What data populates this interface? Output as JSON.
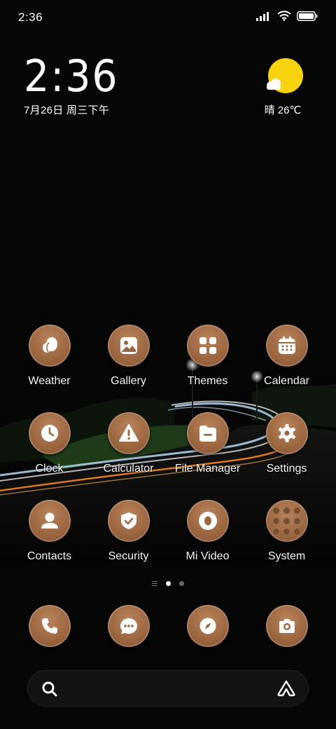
{
  "status_bar": {
    "time": "2:36",
    "icons": [
      "signal-icon",
      "wifi-icon",
      "battery-icon"
    ]
  },
  "clock_widget": {
    "time": "2:36",
    "date": "7月26日 周三下午"
  },
  "weather_widget": {
    "icon": "sun-cloud-icon",
    "text": "晴 26℃"
  },
  "apps": [
    {
      "label": "Weather",
      "icon": "weather-icon"
    },
    {
      "label": "Gallery",
      "icon": "gallery-icon"
    },
    {
      "label": "Themes",
      "icon": "themes-icon"
    },
    {
      "label": "Calendar",
      "icon": "calendar-icon"
    },
    {
      "label": "Clock",
      "icon": "clock-icon"
    },
    {
      "label": "Calculator",
      "icon": "calculator-icon"
    },
    {
      "label": "File Manager",
      "icon": "file-manager-icon"
    },
    {
      "label": "Settings",
      "icon": "settings-icon"
    },
    {
      "label": "Contacts",
      "icon": "contacts-icon"
    },
    {
      "label": "Security",
      "icon": "security-icon"
    },
    {
      "label": "Mi Video",
      "icon": "mi-video-icon"
    },
    {
      "label": "System",
      "icon": "folder-icon"
    }
  ],
  "page_indicator": {
    "pages": 2,
    "active": 1
  },
  "dock": [
    {
      "icon": "phone-icon"
    },
    {
      "icon": "messages-icon"
    },
    {
      "icon": "browser-icon"
    },
    {
      "icon": "camera-icon"
    }
  ],
  "search_bar": {
    "left_icon": "search-icon",
    "right_icon": "assistant-icon"
  },
  "colors": {
    "icon_bg": "#9a6640",
    "glyph": "#ffffff",
    "sun": "#f8d20f",
    "background": "#060606"
  }
}
